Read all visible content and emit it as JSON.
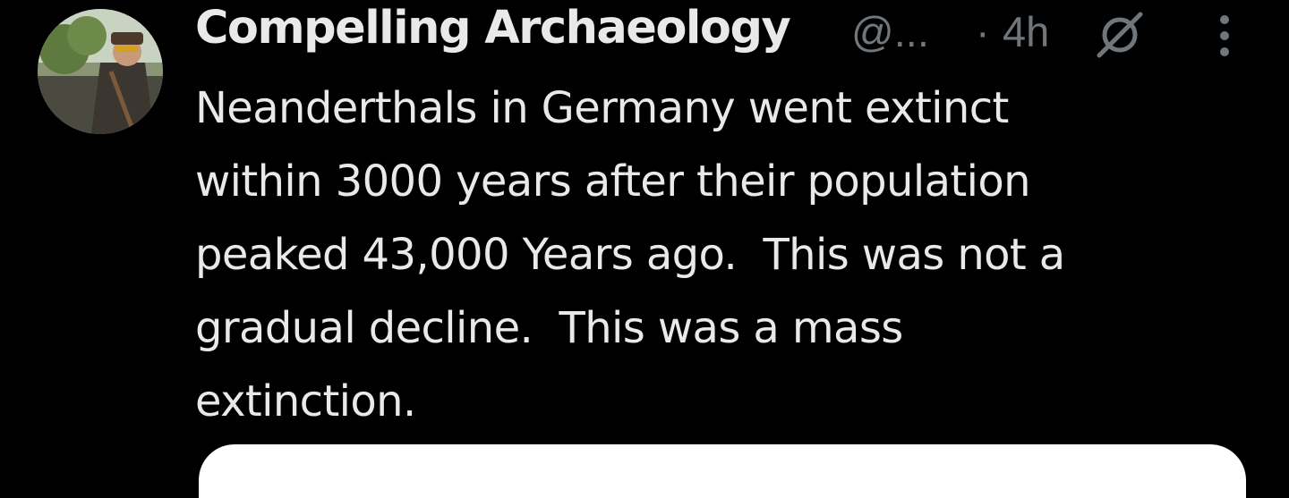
{
  "tweet": {
    "author": {
      "display_name": "Compelling Archaeology",
      "handle": "@...",
      "avatar_icon": "profile-photo"
    },
    "separator": "·",
    "timestamp": "4h",
    "grok_icon": "grok-icon",
    "more_icon": "vertical-ellipsis-icon",
    "text": "Neanderthals in Germany went extinct\nwithin 3000 years after their population\npeaked 43,000 Years ago.  This was not a\ngradual decline.  This was a mass\nextinction."
  },
  "colors": {
    "background": "#000000",
    "primary_text": "#e7e9ea",
    "secondary_text": "#71767b",
    "media_card": "#ffffff"
  }
}
